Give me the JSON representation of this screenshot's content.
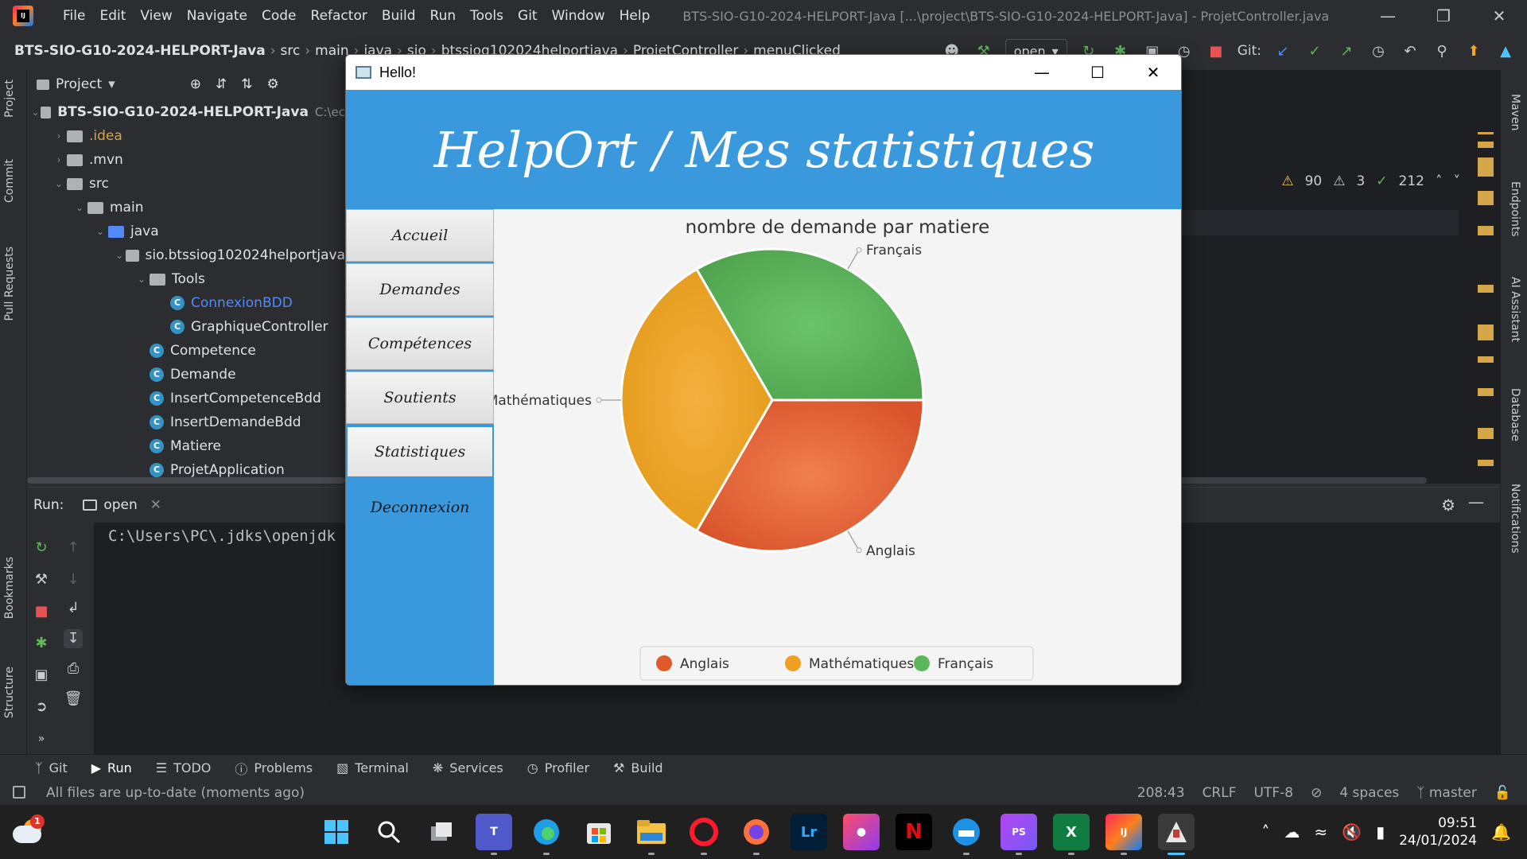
{
  "ide": {
    "menu": [
      "File",
      "Edit",
      "View",
      "Navigate",
      "Code",
      "Refactor",
      "Build",
      "Run",
      "Tools",
      "Git",
      "Window",
      "Help"
    ],
    "window_title": "BTS-SIO-G10-2024-HELPORT-Java [...\\project\\BTS-SIO-G10-2024-HELPORT-Java] - ProjetController.java",
    "breadcrumbs": [
      "BTS-SIO-G10-2024-HELPORT-Java",
      "src",
      "main",
      "java",
      "sio",
      "btssiog102024helportjava",
      "ProjetController",
      "menuClicked"
    ],
    "run_config": "open",
    "git_label": "Git:",
    "project_panel_title": "Project",
    "project_root": "BTS-SIO-G10-2024-HELPORT-Java",
    "project_root_path": "C:\\ec",
    "tree": [
      {
        "label": ".idea",
        "depth": 1,
        "kind": "folder",
        "arrow": "›"
      },
      {
        "label": ".mvn",
        "depth": 1,
        "kind": "folder",
        "arrow": "›"
      },
      {
        "label": "src",
        "depth": 1,
        "kind": "folder",
        "arrow": "⌄"
      },
      {
        "label": "main",
        "depth": 2,
        "kind": "folder",
        "arrow": "⌄"
      },
      {
        "label": "java",
        "depth": 3,
        "kind": "folder-blue",
        "arrow": "⌄"
      },
      {
        "label": "sio.btssiog102024helportjava",
        "depth": 4,
        "kind": "package",
        "arrow": "⌄"
      },
      {
        "label": "Tools",
        "depth": 5,
        "kind": "package",
        "arrow": "⌄"
      },
      {
        "label": "ConnexionBDD",
        "depth": 6,
        "kind": "class",
        "arrow": ""
      },
      {
        "label": "GraphiqueController",
        "depth": 6,
        "kind": "class",
        "arrow": ""
      },
      {
        "label": "Competence",
        "depth": 5,
        "kind": "class",
        "arrow": ""
      },
      {
        "label": "Demande",
        "depth": 5,
        "kind": "class",
        "arrow": ""
      },
      {
        "label": "InsertCompetenceBdd",
        "depth": 5,
        "kind": "class",
        "arrow": ""
      },
      {
        "label": "InsertDemandeBdd",
        "depth": 5,
        "kind": "class",
        "arrow": ""
      },
      {
        "label": "Matiere",
        "depth": 5,
        "kind": "class",
        "arrow": ""
      },
      {
        "label": "ProjetApplication",
        "depth": 5,
        "kind": "class",
        "arrow": ""
      }
    ],
    "inspections": {
      "warnings": "90",
      "weak_warnings": "3",
      "ok": "212"
    },
    "left_tabs": [
      "Project",
      "Commit",
      "Pull Requests",
      "Bookmarks",
      "Structure"
    ],
    "right_tabs": [
      "Maven",
      "Endpoints",
      "AI Assistant",
      "Database",
      "Notifications"
    ],
    "run_panel": {
      "label": "Run:",
      "tab": "open",
      "console": "C:\\Users\\PC\\.jdks\\openjdk"
    },
    "tool_tabs": [
      "Git",
      "Run",
      "TODO",
      "Problems",
      "Terminal",
      "Services",
      "Profiler",
      "Build"
    ],
    "status": {
      "message": "All files are up-to-date (moments ago)",
      "position": "208:43",
      "line_sep": "CRLF",
      "encoding": "UTF-8",
      "indent": "4 spaces",
      "branch": "master"
    }
  },
  "dialog": {
    "title": "Hello!",
    "heading": "HelpOrt / Mes statistiques",
    "nav": [
      {
        "label": "Accueil",
        "selected": false
      },
      {
        "label": "Demandes",
        "selected": false
      },
      {
        "label": "Compétences",
        "selected": false
      },
      {
        "label": "Soutients",
        "selected": false
      },
      {
        "label": "Statistiques",
        "selected": true
      }
    ],
    "logout": "Deconnexion"
  },
  "chart_data": {
    "type": "pie",
    "title": "nombre de demande par matiere",
    "slices": [
      {
        "label": "Anglais",
        "value": 1,
        "color": "#e05a2a"
      },
      {
        "label": "Mathématiques",
        "value": 1,
        "color": "#f0a020"
      },
      {
        "label": "Français",
        "value": 1,
        "color": "#5bb85a"
      }
    ],
    "legend": [
      "Anglais",
      "Mathématiques",
      "Français"
    ],
    "legend_position": "bottom"
  },
  "taskbar": {
    "weather_badge": "1",
    "time": "09:51",
    "date": "24/01/2024"
  },
  "colors": {
    "header_blue": "#3a99dc",
    "ide_bg": "#2b2d30",
    "editor_bg": "#1e1f22"
  }
}
